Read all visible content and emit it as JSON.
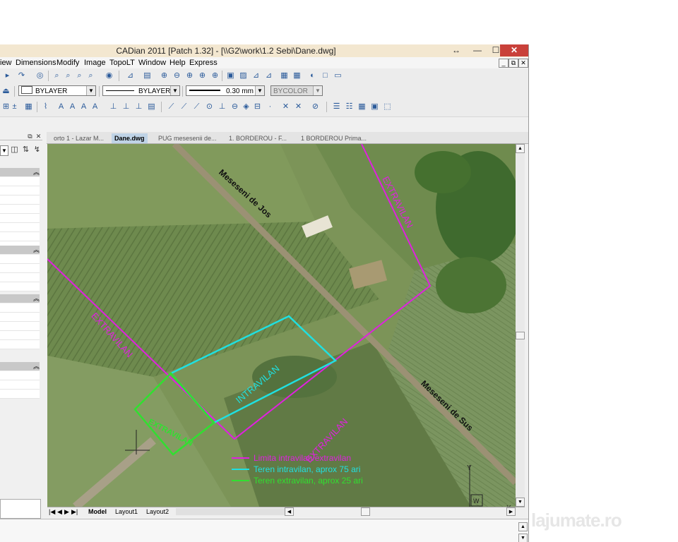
{
  "window": {
    "title": "CADian 2011 [Patch 1.32] - [\\\\G2\\work\\1.2 Sebi\\Dane.dwg]",
    "controls": {
      "restore": "↔",
      "minimize": "—",
      "maximize": "☐",
      "close": "✕"
    },
    "mdi_controls": [
      "_",
      "⧉",
      "✕"
    ]
  },
  "menu": [
    "iew",
    "Dimensions",
    "Modify",
    "Image",
    "TopoLT",
    "Window",
    "Help",
    "Express"
  ],
  "properties_bar": {
    "color": "BYLAYER",
    "linetype": "BYLAYER",
    "lineweight": "0.30 mm",
    "plotstyle": "BYCOLOR"
  },
  "tabs": [
    {
      "label": "orto 1 - Lazar M..."
    },
    {
      "label": "Dane.dwg"
    },
    {
      "label": "PUG mesesenii de..."
    },
    {
      "label": "1. BORDEROU -  F..."
    },
    {
      "label": "1 BORDEROU Prima..."
    }
  ],
  "drawing": {
    "labels": {
      "road_west": "Meseseni de Jos",
      "road_east": "Meseseni de Sus",
      "extravilan": "EXTRAVILAN",
      "intravilan": "INTRAVILAN"
    },
    "legend": [
      {
        "text": "Limita intravilan/extravilan",
        "color": "#e020e0"
      },
      {
        "text": "Teren intravilan, aprox 75 ari",
        "color": "#20e0e0"
      },
      {
        "text": "Teren extravilan, aprox 25 ari",
        "color": "#30e030"
      }
    ],
    "ucs": {
      "x": "X",
      "y": "Y",
      "w": "W"
    },
    "colors": {
      "boundary": "#e020e0",
      "intravilan": "#20e0e0",
      "extravilan": "#30e030"
    }
  },
  "layout_tabs": [
    "Model",
    "Layout1",
    "Layout2"
  ],
  "watermark": "lajumate.ro"
}
